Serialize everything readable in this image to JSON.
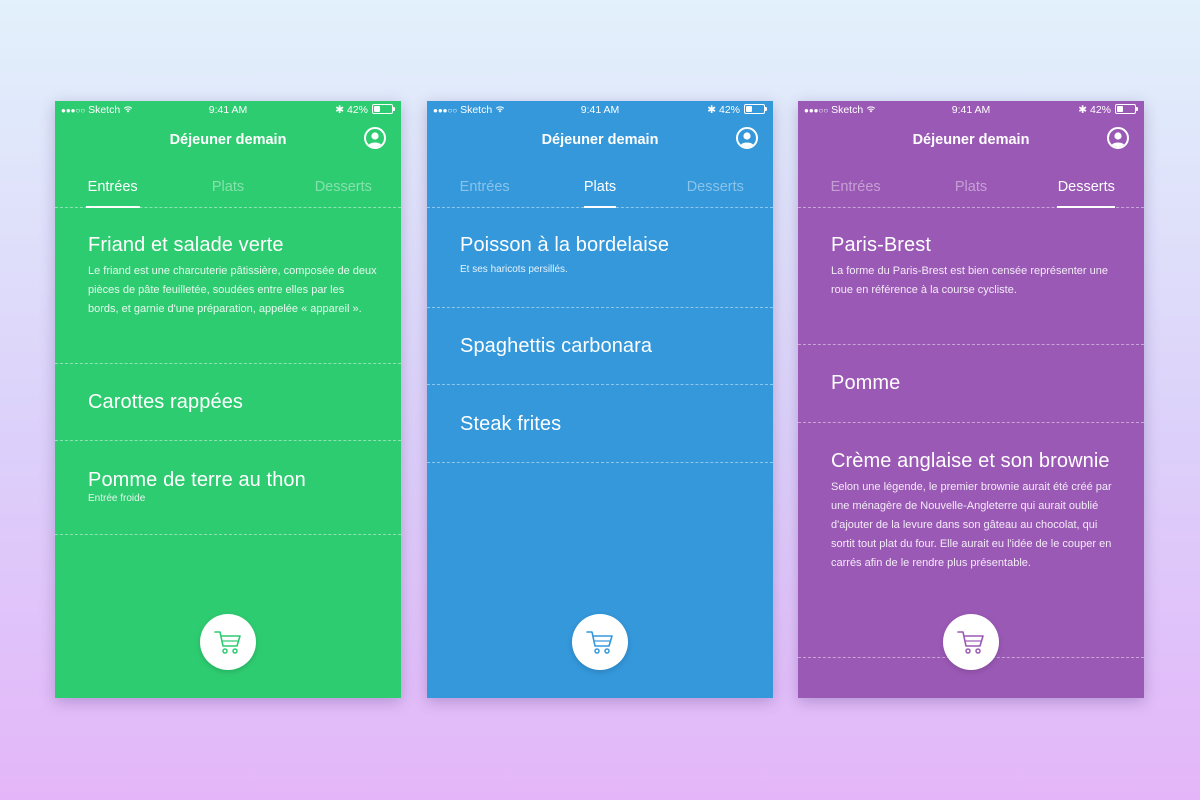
{
  "status_bar": {
    "signal": "●●●○○",
    "carrier": "Sketch",
    "time": "9:41 AM",
    "battery": "42%",
    "battery_level": 0.42
  },
  "screens": [
    {
      "color": "#2ecc71",
      "header_title": "Déjeuner demain",
      "tabs": [
        "Entrées",
        "Plats",
        "Desserts"
      ],
      "active_tab": "Entrées",
      "items": [
        {
          "title": "Friand et salade verte",
          "description": "Le friand est une charcuterie pâtissière, composée de deux pièces de pâte feuilletée, soudées entre elles par les bords, et garnie d'une préparation, appelée « appareil »."
        },
        {
          "title": "Carottes rappées"
        },
        {
          "title": "Pomme de terre au thon",
          "subtitle": "Entrée froide"
        }
      ]
    },
    {
      "color": "#3498db",
      "header_title": "Déjeuner demain",
      "tabs": [
        "Entrées",
        "Plats",
        "Desserts"
      ],
      "active_tab": "Plats",
      "items": [
        {
          "title": "Poisson à la bordelaise",
          "subtitle": "Et ses haricots persillés."
        },
        {
          "title": "Spaghettis carbonara"
        },
        {
          "title": "Steak frites"
        }
      ]
    },
    {
      "color": "#9b59b6",
      "header_title": "Déjeuner demain",
      "tabs": [
        "Entrées",
        "Plats",
        "Desserts"
      ],
      "active_tab": "Desserts",
      "items": [
        {
          "title": "Paris-Brest",
          "description": "La forme du Paris-Brest est bien censée représenter une roue en référence à la course cycliste."
        },
        {
          "title": "Pomme"
        },
        {
          "title": "Crème anglaise et son brownie",
          "description": "Selon une légende, le premier brownie aurait été créé par une ménagère de Nouvelle-Angleterre qui aurait oublié d'ajouter de la levure dans son gâteau au chocolat, qui sortit tout plat du four. Elle aurait eu l'idée de le couper en carrés afin de le rendre plus présentable."
        }
      ]
    }
  ]
}
